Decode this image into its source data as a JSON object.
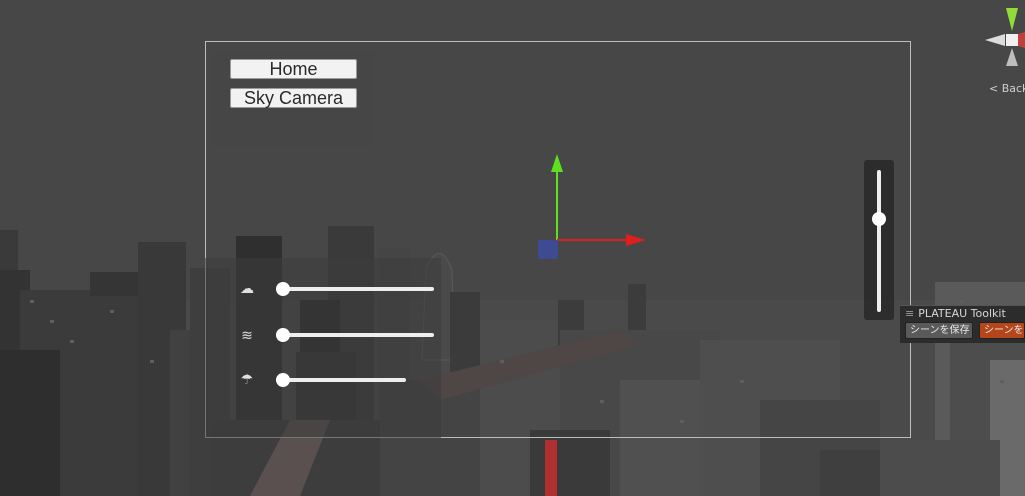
{
  "overlay": {
    "buttons": [
      {
        "label": "Home"
      },
      {
        "label": "Sky Camera"
      }
    ],
    "sliders": [
      {
        "icon": "sun-cloud-icon",
        "value": 0.0
      },
      {
        "icon": "wind-icon",
        "value": 0.0
      },
      {
        "icon": "rain-icon",
        "value": 0.0
      }
    ],
    "vertical_slider": {
      "value": 0.33
    }
  },
  "toolkit": {
    "title": "PLATEAU Toolkit",
    "save_label": "シーンを保存",
    "open_label": "シーンを開く"
  },
  "scene_gizmo": {
    "back_label": "< Back"
  },
  "colors": {
    "x_axis": "#e01e1e",
    "y_axis": "#5ee01e",
    "z_axis": "#3a4cb0",
    "accent": "#b5451b"
  }
}
